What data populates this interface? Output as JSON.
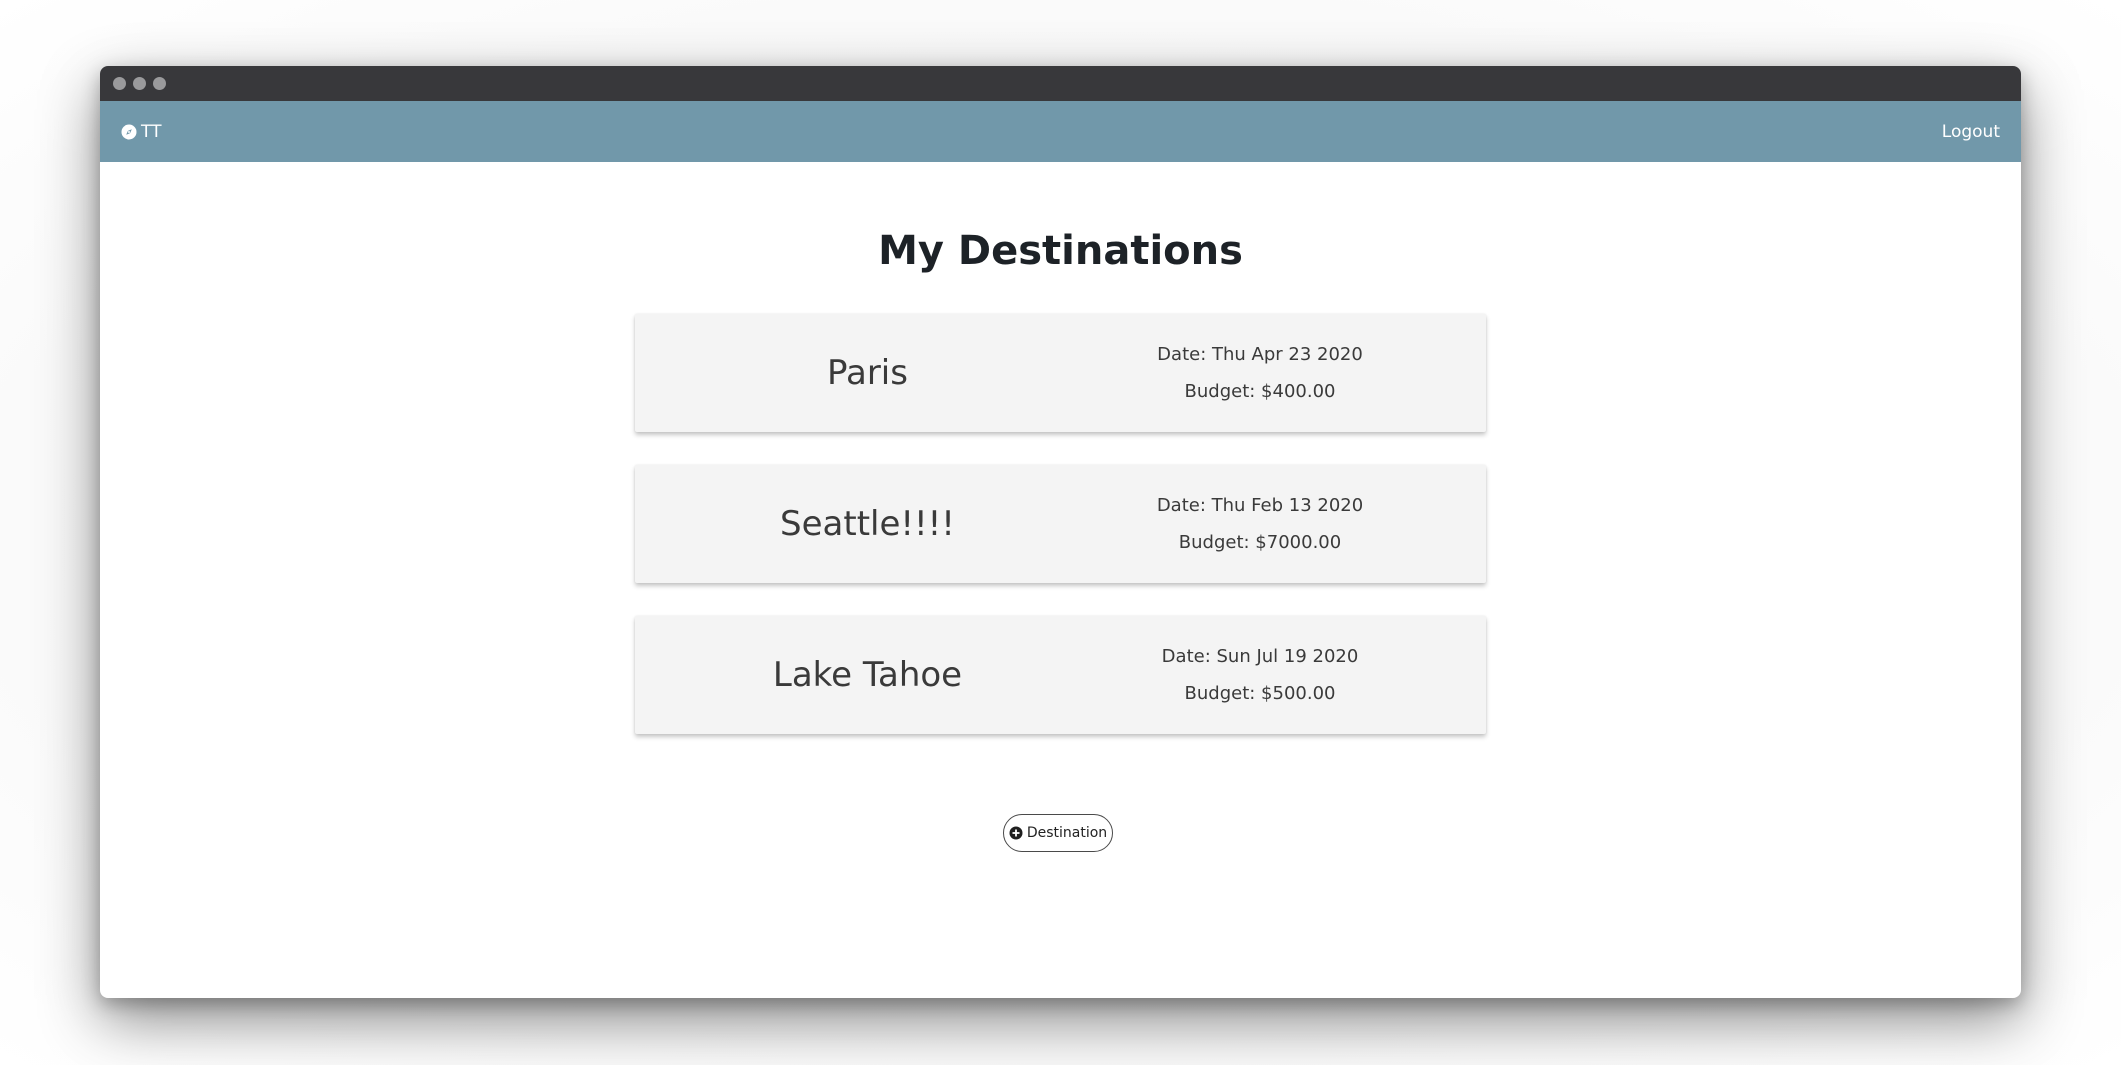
{
  "navbar": {
    "brand_text": "TT",
    "brand_icon": "compass-icon",
    "logout_label": "Logout",
    "background": "#7198aa"
  },
  "page": {
    "title": "My Destinations"
  },
  "destinations": [
    {
      "name": "Paris",
      "date": "Date: Thu Apr 23 2020",
      "budget": "Budget: $400.00"
    },
    {
      "name": "Seattle!!!!",
      "date": "Date: Thu Feb 13 2020",
      "budget": "Budget: $7000.00"
    },
    {
      "name": "Lake Tahoe",
      "date": "Date: Sun Jul 19 2020",
      "budget": "Budget: $500.00"
    }
  ],
  "add_button": {
    "label": "Destination",
    "icon": "plus-circle-icon"
  }
}
